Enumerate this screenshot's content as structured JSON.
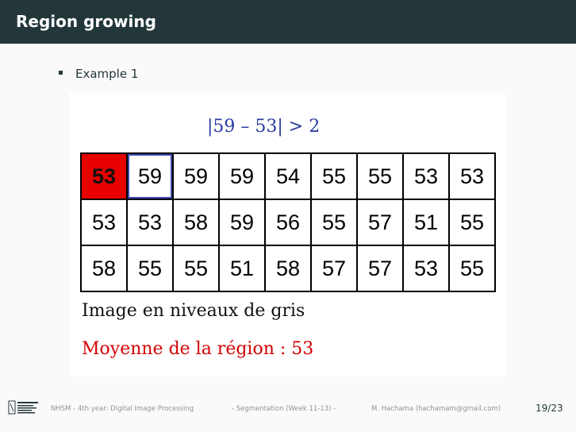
{
  "slide": {
    "title": "Region growing",
    "bullet": "Example 1"
  },
  "figure": {
    "formula": "|59 – 53| > 2",
    "grid": [
      [
        "53",
        "59",
        "59",
        "59",
        "54",
        "55",
        "55",
        "53",
        "53"
      ],
      [
        "53",
        "53",
        "58",
        "59",
        "56",
        "55",
        "57",
        "51",
        "55"
      ],
      [
        "58",
        "55",
        "55",
        "51",
        "58",
        "57",
        "57",
        "53",
        "55"
      ]
    ],
    "seed_cell": "row 1, col 1",
    "active_cell": "row 1, col 2",
    "caption": "Image en niveaux de gris",
    "mean_label": "Moyenne de la région : 53"
  },
  "footer": {
    "course": "NHSM - 4th year: Digital Image Processing",
    "section": "- Segmentation (Week 11-13) -",
    "author": "M. Hachama (hachamam@gmail.com)",
    "page": "19/23"
  },
  "colors": {
    "header_bg": "#23373b",
    "seed": "#e80000",
    "active_border": "#3a4aa8",
    "formula": "#2a3aa0",
    "mean": "#d40000"
  }
}
